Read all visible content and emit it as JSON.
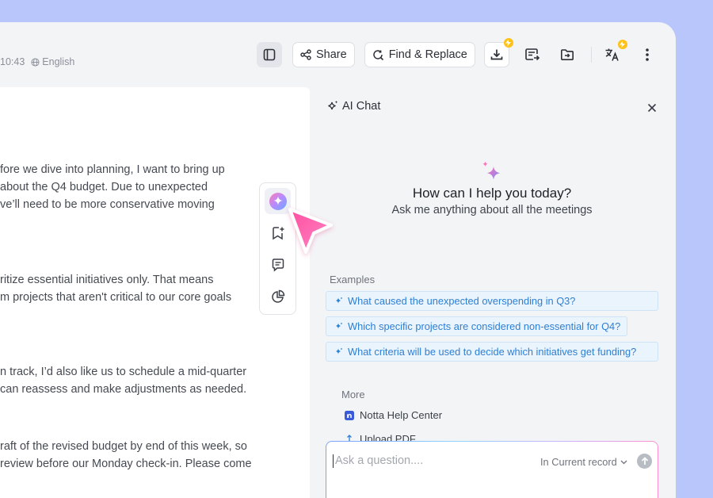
{
  "header": {
    "time": "10:43",
    "language": "English"
  },
  "toolbar": {
    "share_label": "Share",
    "find_replace_label": "Find & Replace"
  },
  "transcript": {
    "paragraphs": [
      {
        "lines": [
          "fore we dive into planning, I want to bring up",
          " about the Q4 budget. Due to unexpected",
          "ve’ll need to be more conservative moving"
        ]
      },
      {
        "lines": [
          "ritize essential initiatives only. That means",
          "m projects that aren't critical to our core goals"
        ]
      },
      {
        "lines": [
          "n track, I’d also like us to schedule a mid-quarter",
          "can reassess and make adjustments as needed."
        ]
      },
      {
        "lines": [
          "raft of the revised budget by end of this week, so",
          "review before our Monday check-in. Please come"
        ]
      }
    ]
  },
  "chat": {
    "title": "AI Chat",
    "hero_title": "How can I help you today?",
    "hero_subtitle": "Ask me anything about all the meetings",
    "examples_label": "Examples",
    "examples": [
      "What caused the unexpected overspending in Q3?",
      "Which specific projects are considered non-essential for Q4?",
      "What criteria will be used to decide which initiatives get funding?"
    ],
    "more_label": "More",
    "more_items": [
      "Notta Help Center",
      "Upload PDF"
    ],
    "ask_placeholder": "Ask a question....",
    "scope": "In Current record"
  },
  "colors": {
    "background": "#b9c6fb",
    "link_blue": "#2e7fd3",
    "badge_yellow": "#ffc21a",
    "cursor_pink": "#ff5fa8"
  }
}
